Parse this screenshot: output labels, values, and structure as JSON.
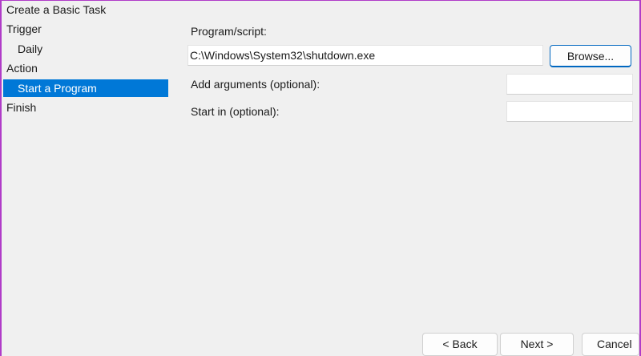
{
  "nav": {
    "title": "Create a Basic Task",
    "items": [
      {
        "label": "Trigger"
      },
      {
        "label": "Daily"
      },
      {
        "label": "Action"
      },
      {
        "label": "Start a Program"
      },
      {
        "label": "Finish"
      }
    ]
  },
  "form": {
    "program_label": "Program/script:",
    "program_value": "C:\\Windows\\System32\\shutdown.exe",
    "browse_label": "Browse...",
    "args_label": "Add arguments (optional):",
    "args_value": "",
    "startin_label": "Start in (optional):",
    "startin_value": ""
  },
  "footer": {
    "back_label": "< Back",
    "next_label": "Next >",
    "cancel_label": "Cancel"
  },
  "colors": {
    "selected_bg": "#0078d7",
    "accent": "#0067c0",
    "window_bg": "#f0f0f0"
  }
}
